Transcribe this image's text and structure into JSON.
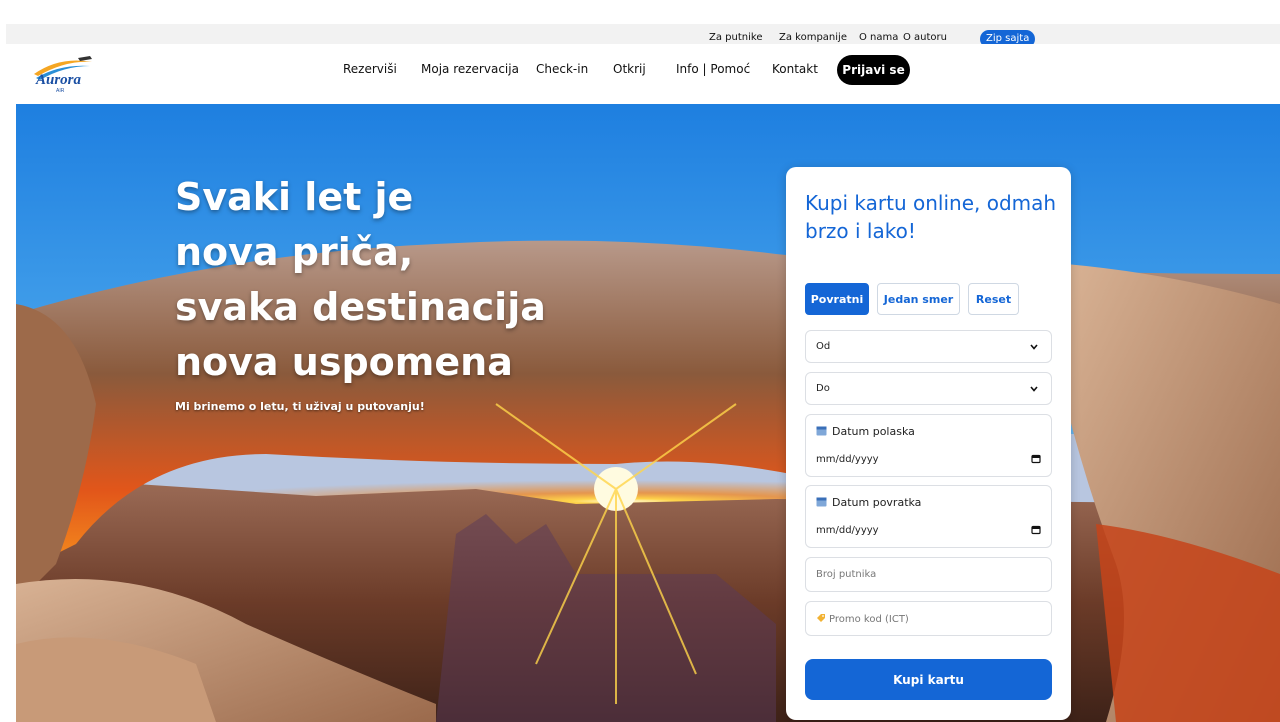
{
  "utility_nav": {
    "links": [
      "Za putnike",
      "Za kompanije",
      "O nama",
      "O autoru"
    ],
    "zip_label": "Zip sajta"
  },
  "brand": {
    "logo_text": "Aurora",
    "logo_subtext": "AIR"
  },
  "main_nav": {
    "items": [
      "Rezerviši",
      "Moja rezervacija",
      "Check-in",
      "Otkrij",
      "Info | Pomoć",
      "Kontakt"
    ],
    "login_label": "Prijavi se"
  },
  "hero": {
    "headline_lines": [
      "Svaki let je",
      "nova priča,",
      "svaka destinacija",
      "nova uspomena"
    ],
    "subline": "Mi brinemo o letu, ti uživaj u putovanju!"
  },
  "booking": {
    "title": "Kupi kartu online, odmah brzo i lako!",
    "tabs": {
      "round_trip": "Povratni",
      "one_way": "Jedan smer",
      "reset": "Reset"
    },
    "from_select": "Od",
    "to_select": "Do",
    "departure_label": "Datum polaska",
    "departure_value": "mm/dd/yyyy",
    "return_label": "Datum povratka",
    "return_value": "mm/dd/yyyy",
    "passengers_placeholder": "Broj putnika",
    "promo_placeholder": "Promo kod (ICT)",
    "buy_label": "Kupi kartu"
  },
  "colors": {
    "accent": "#1466d6",
    "nav_button": "#000000",
    "utility_bg": "#f2f2f2"
  }
}
